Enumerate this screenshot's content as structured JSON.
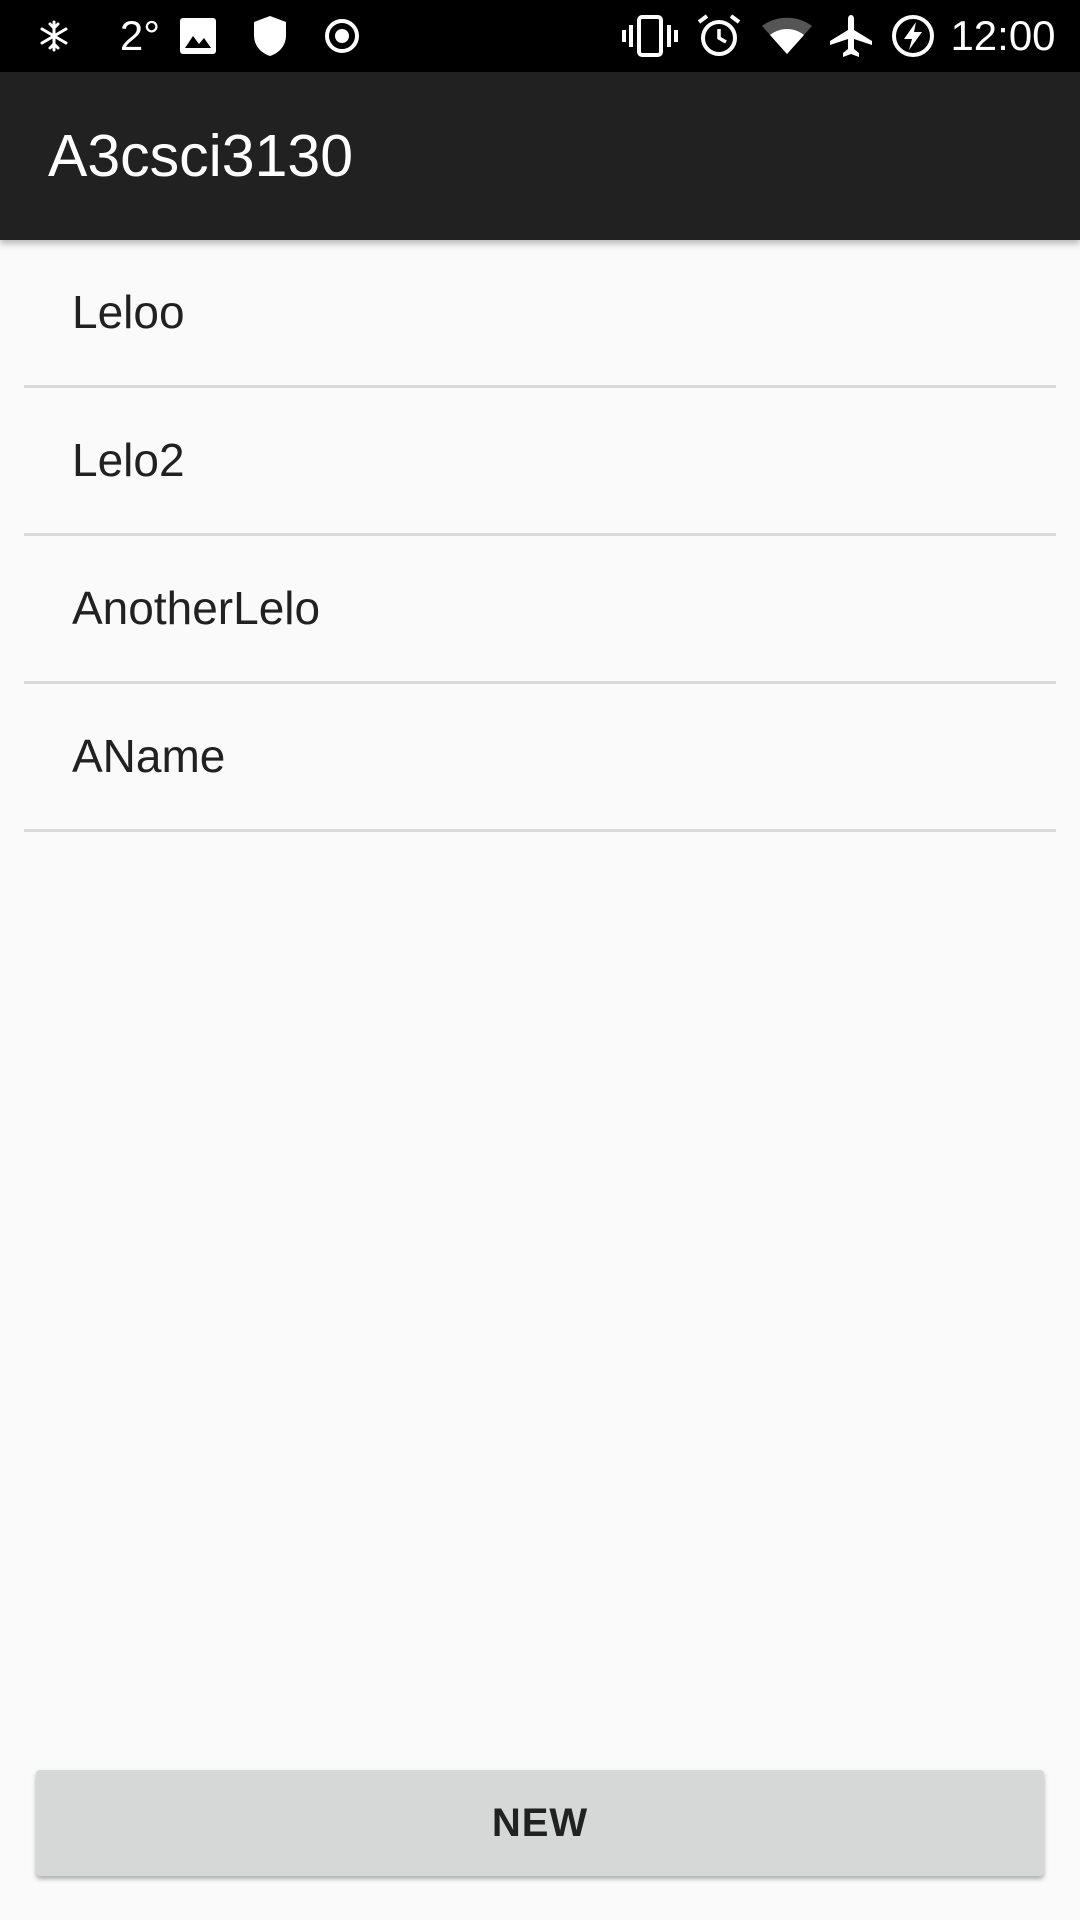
{
  "status_bar": {
    "icons_left": [
      "snowflake-icon",
      "image-icon",
      "shield-icon",
      "radio-button-icon"
    ],
    "temperature": "2°",
    "icons_right": [
      "vibrate-icon",
      "alarm-icon",
      "wifi-icon",
      "airplane-icon",
      "battery-charging-icon"
    ],
    "time": "12:00"
  },
  "app_bar": {
    "title": "A3csci3130",
    "background": "#212121"
  },
  "list": {
    "items": [
      {
        "label": "Leloo"
      },
      {
        "label": "Lelo2"
      },
      {
        "label": "AnotherLelo"
      },
      {
        "label": "AName"
      }
    ]
  },
  "actions": {
    "new_label": "NEW"
  },
  "colors": {
    "background": "#fafafa",
    "divider": "#dadada",
    "button": "#d6d7d7"
  }
}
